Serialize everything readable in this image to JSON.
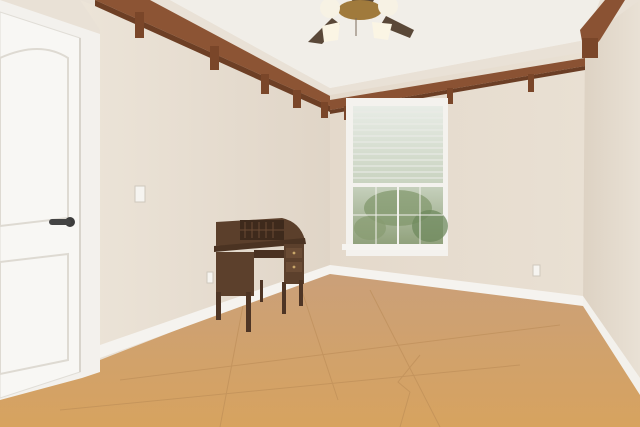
{
  "scene": {
    "kind": "interior-room-photo",
    "objects": [
      "door-panel-icon",
      "door-lever-icon",
      "ceiling-fan-icon",
      "window-blinds-icon",
      "roll-top-desk-icon",
      "light-switch-icon",
      "wall-outlet-icon",
      "wood-rail-icon",
      "baseboard-icon",
      "tile-floor-icon"
    ],
    "colors": {
      "wall": "#e6dccf",
      "wall_shadow": "#d9cebf",
      "ceiling": "#f3f1ec",
      "wood_rail": "#8a5233",
      "desk": "#5a3f2c",
      "floor": "#d9a86a",
      "door": "#f7f6f3",
      "trim": "#f4f2ee",
      "window_glass": "#cfd9c9"
    }
  }
}
